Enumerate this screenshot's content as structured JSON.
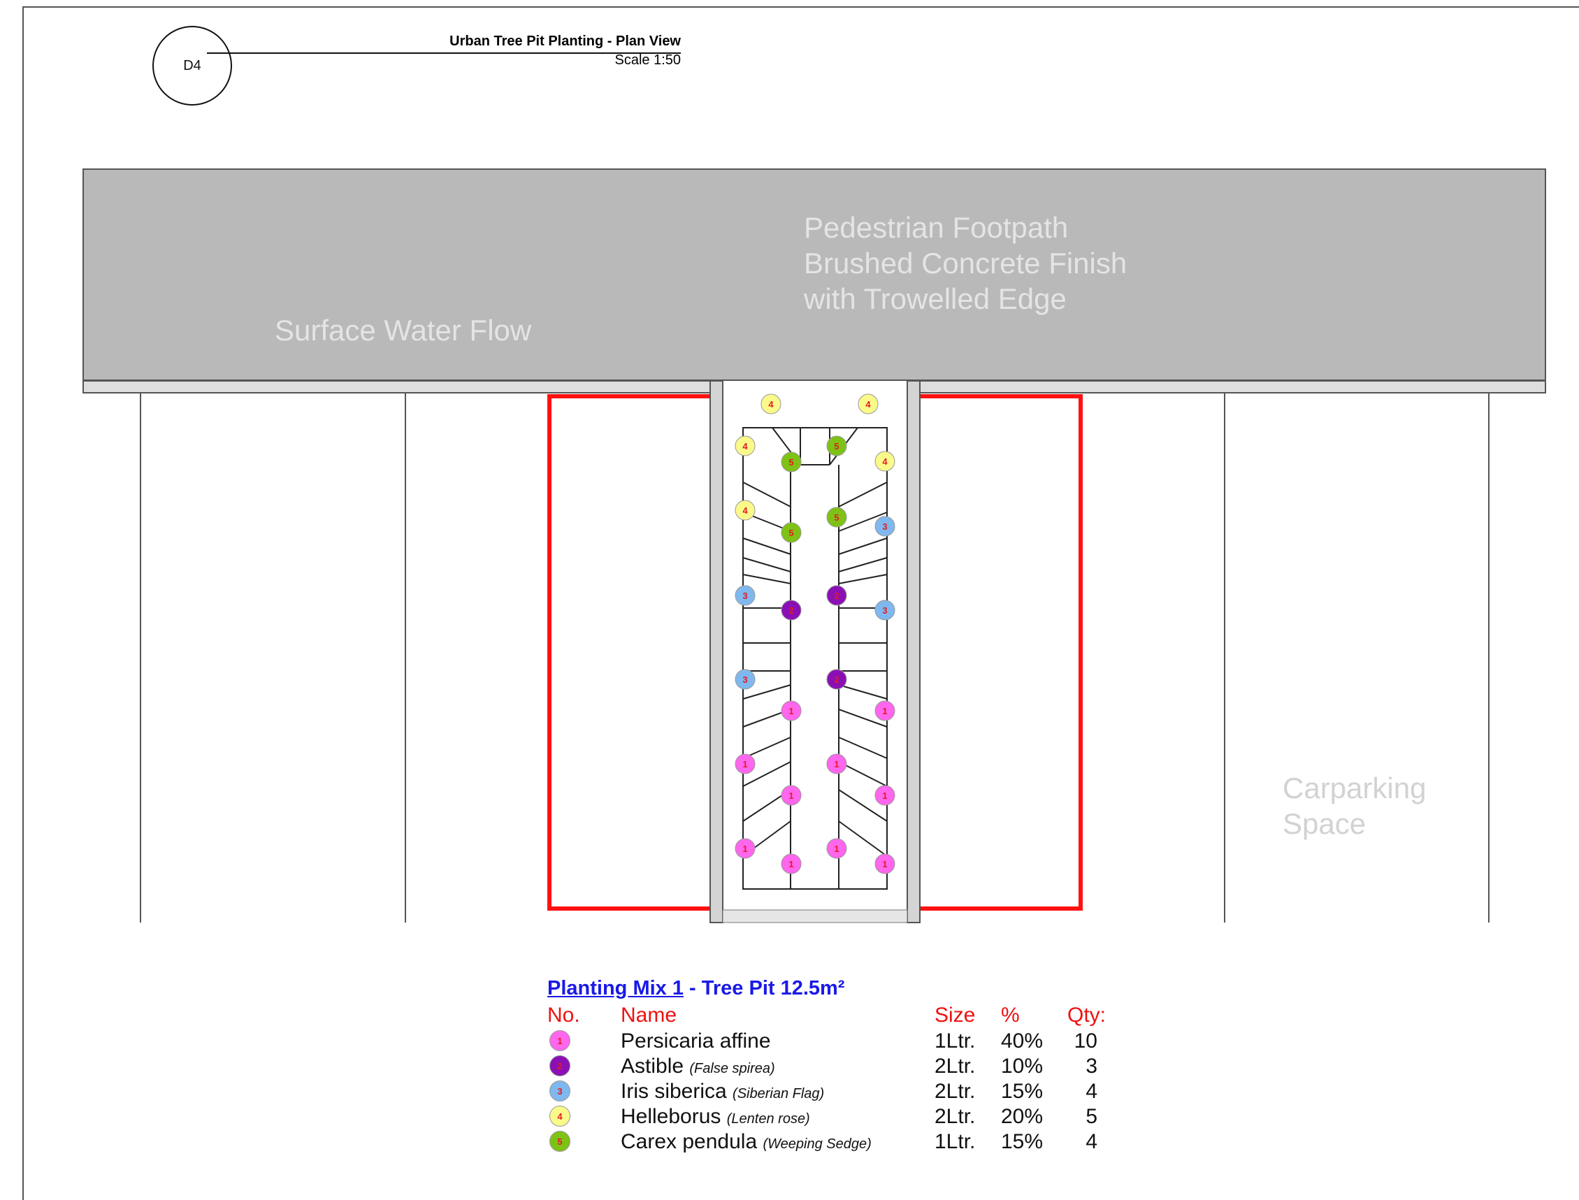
{
  "title_block": {
    "detail_ref": "D4",
    "title": "Urban Tree Pit Planting - Plan View",
    "scale": "Scale 1:50"
  },
  "labels": {
    "footpath": [
      "Pedestrian Footpath",
      "Brushed Concrete Finish",
      "with Trowelled Edge"
    ],
    "water_flow": "Surface Water Flow",
    "parking": [
      "Carparking",
      "Space"
    ]
  },
  "colors": {
    "footpath": "#b9b9b9",
    "pit_outline": "#ff1111",
    "kerb": "#d9d9d9",
    "species_1": "#ff66ee",
    "species_2": "#8a10b5",
    "species_3": "#7fb8ee",
    "species_4": "#fafa8a",
    "species_5": "#7ec216",
    "number_text": "#e31b23",
    "legend_title": "#1a1ae6",
    "legend_header": "#ee1111"
  },
  "plants": [
    {
      "n": 4
    },
    {
      "n": 4
    },
    {
      "n": 4
    },
    {
      "n": 5
    },
    {
      "n": 5
    },
    {
      "n": 4
    },
    {
      "n": 4
    },
    {
      "n": 5
    },
    {
      "n": 5
    },
    {
      "n": 3
    },
    {
      "n": 3
    },
    {
      "n": 2
    },
    {
      "n": 2
    },
    {
      "n": 3
    },
    {
      "n": 3
    },
    {
      "n": 2
    },
    {
      "n": 1
    },
    {
      "n": 1
    },
    {
      "n": 1
    },
    {
      "n": 1
    },
    {
      "n": 1
    },
    {
      "n": 1
    },
    {
      "n": 1
    },
    {
      "n": 1
    },
    {
      "n": 1
    },
    {
      "n": 1
    }
  ],
  "legend": {
    "title_main": "Planting Mix 1",
    "title_rest": " - Tree Pit 12.5m²",
    "headers": {
      "no": "No.",
      "name": "Name",
      "size": "Size",
      "pct": "%",
      "qty": "Qty:"
    },
    "rows": [
      {
        "num": "1",
        "name": "Persicaria affine",
        "common": "",
        "size": "1Ltr.",
        "pct": "40%",
        "qty": "10"
      },
      {
        "num": "2",
        "name": "Astible",
        "common": "(False spirea)",
        "size": "2Ltr.",
        "pct": "10%",
        "qty": "3"
      },
      {
        "num": "3",
        "name": "Iris siberica",
        "common": "(Siberian Flag)",
        "size": "2Ltr.",
        "pct": "15%",
        "qty": "4"
      },
      {
        "num": "4",
        "name": "Helleborus",
        "common": "(Lenten rose)",
        "size": "2Ltr.",
        "pct": "20%",
        "qty": "5"
      },
      {
        "num": "5",
        "name": "Carex pendula",
        "common": "(Weeping Sedge)",
        "size": "1Ltr.",
        "pct": "15%",
        "qty": "4"
      }
    ]
  }
}
